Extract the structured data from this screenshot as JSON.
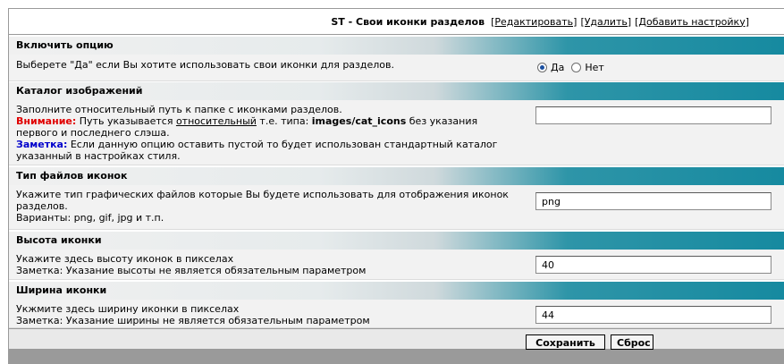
{
  "header": {
    "title": "ST - Свои иконки разделов",
    "links": [
      "[Редактировать]",
      "[Удалить]",
      "[Добавить настройку]"
    ]
  },
  "sections": [
    {
      "title": "Включить опцию",
      "description": "Выберете \"Да\" если Вы хотите использовать свои иконки для разделов.",
      "radio": {
        "yes_label": "Да",
        "no_label": "Нет",
        "selected": "Да"
      }
    },
    {
      "title": "Каталог изображений",
      "line1": "Заполните относительный путь к папке с иконками разделов.",
      "warn_label": "Внимание:",
      "warn_a": " Путь указывается ",
      "warn_link": "относительный",
      "warn_b": " т.е. типа: ",
      "warn_code": "images/cat_icons",
      "warn_c": " без указания первого и последнего слэша.",
      "note_label": "Заметка:",
      "note_text": " Если данную опцию оставить пустой то будет использован стандартный каталог указанный в настройках стиля.",
      "value": ""
    },
    {
      "title": "Тип файлов иконок",
      "line1": "Укажите тип графических файлов которые Вы будете использовать для отображения иконок разделов.",
      "line2": "Варианты: png, gif, jpg и т.п.",
      "value": "png"
    },
    {
      "title": "Высота иконки",
      "line1": "Укажите здесь высоту иконок в пикселах",
      "line2": "Заметка: Указание высоты не является обязательным параметром",
      "value": "40"
    },
    {
      "title": "Ширина иконки",
      "line1": "Укжмите здесь ширину иконки в пикселах",
      "line2": "Заметка: Указание ширины не является обязательным параметром",
      "value": "44"
    }
  ],
  "buttons": {
    "save": "Сохранить",
    "reset": "Сброс"
  }
}
